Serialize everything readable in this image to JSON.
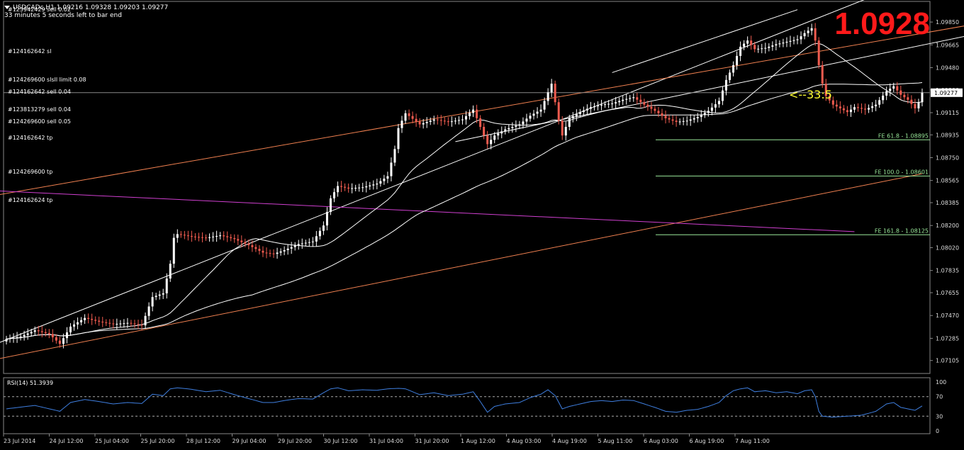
{
  "header": {
    "symbol_line": "USDCADc,H1  1.09216 1.09328 1.09203 1.09277",
    "timer_text": "33 minutes 5 seconds left to bar end"
  },
  "big_price": "1.0928",
  "countdown_label": "<--33:5",
  "orders": [
    {
      "label": "#123942429 sell 0.02",
      "price": 1.0995
    },
    {
      "label": "#124162642 sl",
      "price": 1.0961
    },
    {
      "label": "#124269600 slsll limit 0.08",
      "price": 1.0938
    },
    {
      "label": "#124162642 sell 0.04",
      "price": 1.0928
    },
    {
      "label": "#123813279 sell 0.04",
      "price": 1.0914
    },
    {
      "label": "#124269600 sell 0.05",
      "price": 1.0904
    },
    {
      "label": "#124162642 tp",
      "price": 1.0891
    },
    {
      "label": "#124269600 tp",
      "price": 1.0863
    },
    {
      "label": "#124162624 tp",
      "price": 1.084
    }
  ],
  "fibo_levels": [
    {
      "label": "FE 61.8 - 1.08895",
      "price": 1.08895
    },
    {
      "label": "FE 100.0 - 1.08601",
      "price": 1.08601
    },
    {
      "label": "FE 161.8 - 1.08125",
      "price": 1.08125
    }
  ],
  "rsi": {
    "label": "RSI(14) 51.3939",
    "ticks": [
      "100",
      "70",
      "30",
      "0"
    ],
    "levels": [
      70,
      30
    ]
  },
  "colors": {
    "background": "#000000",
    "bull_candle": "#ffffff",
    "bear_candle": "#ef5b4f",
    "channel": "#ffffff",
    "trend_orange": "#f08050",
    "trend_magenta": "#d040d0",
    "fibo": "#9ae89a",
    "rsi_line": "#3f7fe0",
    "big_price": "#ff1a1a",
    "countdown": "#ffff33"
  },
  "chart_data": {
    "type": "candlestick",
    "symbol": "USDCADc",
    "timeframe": "H1",
    "current_price": 1.09277,
    "current_price_label": "1.09277",
    "ylim": [
      1.07,
      1.1
    ],
    "yticks": [
      "1.09850",
      "1.09665",
      "1.09480",
      "1.09300",
      "1.09115",
      "1.08935",
      "1.08750",
      "1.08565",
      "1.08385",
      "1.08200",
      "1.08020",
      "1.07835",
      "1.07655",
      "1.07470",
      "1.07285",
      "1.07105"
    ],
    "xticks": [
      "23 Jul 2014",
      "24 Jul 12:00",
      "25 Jul 04:00",
      "25 Jul 20:00",
      "28 Jul 12:00",
      "29 Jul 04:00",
      "29 Jul 20:00",
      "30 Jul 12:00",
      "31 Jul 04:00",
      "31 Jul 20:00",
      "1 Aug 12:00",
      "4 Aug 03:00",
      "4 Aug 19:00",
      "5 Aug 11:00",
      "6 Aug 03:00",
      "6 Aug 19:00",
      "7 Aug 11:00"
    ],
    "close_path": [
      [
        0,
        1.0728
      ],
      [
        4,
        1.073
      ],
      [
        8,
        1.0735
      ],
      [
        12,
        1.0732
      ],
      [
        15,
        1.0724
      ],
      [
        18,
        1.0738
      ],
      [
        22,
        1.0745
      ],
      [
        26,
        1.0742
      ],
      [
        30,
        1.074
      ],
      [
        34,
        1.0741
      ],
      [
        38,
        1.0739
      ],
      [
        41,
        1.0762
      ],
      [
        44,
        1.0765
      ],
      [
        46,
        1.0789
      ],
      [
        47,
        1.081
      ],
      [
        48,
        1.0813
      ],
      [
        52,
        1.0811
      ],
      [
        56,
        1.081
      ],
      [
        60,
        1.0812
      ],
      [
        64,
        1.0809
      ],
      [
        68,
        1.0804
      ],
      [
        72,
        1.0798
      ],
      [
        75,
        1.0797
      ],
      [
        78,
        1.08
      ],
      [
        82,
        1.0805
      ],
      [
        86,
        1.0807
      ],
      [
        89,
        1.082
      ],
      [
        91,
        1.0842
      ],
      [
        93,
        1.0852
      ],
      [
        96,
        1.085
      ],
      [
        100,
        1.0851
      ],
      [
        104,
        1.0854
      ],
      [
        107,
        1.086
      ],
      [
        109,
        1.0882
      ],
      [
        110,
        1.0899
      ],
      [
        112,
        1.0911
      ],
      [
        116,
        1.0902
      ],
      [
        120,
        1.0906
      ],
      [
        124,
        1.0904
      ],
      [
        128,
        1.0906
      ],
      [
        131,
        1.0914
      ],
      [
        133,
        1.09
      ],
      [
        135,
        1.0886
      ],
      [
        137,
        1.0893
      ],
      [
        140,
        1.0898
      ],
      [
        144,
        1.0902
      ],
      [
        147,
        1.0909
      ],
      [
        150,
        1.0914
      ],
      [
        152,
        1.0928
      ],
      [
        153,
        1.0935
      ],
      [
        154,
        1.092
      ],
      [
        155,
        1.0905
      ],
      [
        156,
        1.0893
      ],
      [
        158,
        1.0907
      ],
      [
        161,
        1.0912
      ],
      [
        164,
        1.0916
      ],
      [
        167,
        1.0918
      ],
      [
        170,
        1.0919
      ],
      [
        173,
        1.0922
      ],
      [
        176,
        1.0924
      ],
      [
        179,
        1.0918
      ],
      [
        182,
        1.0913
      ],
      [
        185,
        1.0907
      ],
      [
        188,
        1.0904
      ],
      [
        191,
        1.0905
      ],
      [
        194,
        1.0908
      ],
      [
        197,
        1.0913
      ],
      [
        200,
        1.0921
      ],
      [
        202,
        1.0938
      ],
      [
        204,
        1.095
      ],
      [
        206,
        1.0965
      ],
      [
        208,
        1.097
      ],
      [
        210,
        1.0963
      ],
      [
        213,
        1.0964
      ],
      [
        216,
        1.0967
      ],
      [
        219,
        1.0969
      ],
      [
        222,
        1.0971
      ],
      [
        224,
        1.0976
      ],
      [
        226,
        1.098
      ],
      [
        227,
        1.097
      ],
      [
        228,
        1.095
      ],
      [
        229,
        1.0935
      ],
      [
        230,
        1.0925
      ],
      [
        232,
        1.0918
      ],
      [
        234,
        1.0915
      ],
      [
        236,
        1.0912
      ],
      [
        238,
        1.0916
      ],
      [
        241,
        1.0914
      ],
      [
        244,
        1.0918
      ],
      [
        247,
        1.0929
      ],
      [
        249,
        1.0933
      ],
      [
        251,
        1.0926
      ],
      [
        253,
        1.0922
      ],
      [
        255,
        1.0915
      ],
      [
        256,
        1.092
      ],
      [
        257,
        1.09277
      ]
    ],
    "rsi_values": [
      [
        0,
        45
      ],
      [
        8,
        52
      ],
      [
        15,
        40
      ],
      [
        18,
        58
      ],
      [
        22,
        64
      ],
      [
        26,
        60
      ],
      [
        30,
        55
      ],
      [
        34,
        58
      ],
      [
        38,
        56
      ],
      [
        41,
        75
      ],
      [
        44,
        72
      ],
      [
        46,
        86
      ],
      [
        48,
        88
      ],
      [
        52,
        85
      ],
      [
        56,
        80
      ],
      [
        60,
        83
      ],
      [
        64,
        74
      ],
      [
        68,
        66
      ],
      [
        72,
        58
      ],
      [
        75,
        58
      ],
      [
        78,
        62
      ],
      [
        82,
        66
      ],
      [
        86,
        65
      ],
      [
        89,
        78
      ],
      [
        91,
        86
      ],
      [
        93,
        88
      ],
      [
        96,
        82
      ],
      [
        100,
        84
      ],
      [
        104,
        83
      ],
      [
        107,
        86
      ],
      [
        110,
        87
      ],
      [
        112,
        86
      ],
      [
        116,
        74
      ],
      [
        120,
        78
      ],
      [
        124,
        72
      ],
      [
        128,
        75
      ],
      [
        131,
        80
      ],
      [
        133,
        60
      ],
      [
        135,
        38
      ],
      [
        137,
        50
      ],
      [
        140,
        55
      ],
      [
        144,
        58
      ],
      [
        147,
        68
      ],
      [
        150,
        75
      ],
      [
        152,
        84
      ],
      [
        154,
        72
      ],
      [
        156,
        45
      ],
      [
        158,
        50
      ],
      [
        161,
        55
      ],
      [
        164,
        60
      ],
      [
        167,
        62
      ],
      [
        170,
        60
      ],
      [
        173,
        63
      ],
      [
        176,
        62
      ],
      [
        179,
        55
      ],
      [
        182,
        48
      ],
      [
        185,
        40
      ],
      [
        188,
        38
      ],
      [
        191,
        42
      ],
      [
        194,
        44
      ],
      [
        197,
        50
      ],
      [
        200,
        58
      ],
      [
        202,
        72
      ],
      [
        204,
        82
      ],
      [
        206,
        86
      ],
      [
        208,
        88
      ],
      [
        210,
        80
      ],
      [
        213,
        82
      ],
      [
        216,
        78
      ],
      [
        219,
        80
      ],
      [
        222,
        76
      ],
      [
        224,
        82
      ],
      [
        226,
        84
      ],
      [
        227,
        70
      ],
      [
        228,
        40
      ],
      [
        229,
        30
      ],
      [
        232,
        28
      ],
      [
        236,
        30
      ],
      [
        240,
        32
      ],
      [
        244,
        40
      ],
      [
        247,
        55
      ],
      [
        249,
        58
      ],
      [
        251,
        48
      ],
      [
        253,
        45
      ],
      [
        255,
        42
      ],
      [
        257,
        51
      ]
    ]
  }
}
